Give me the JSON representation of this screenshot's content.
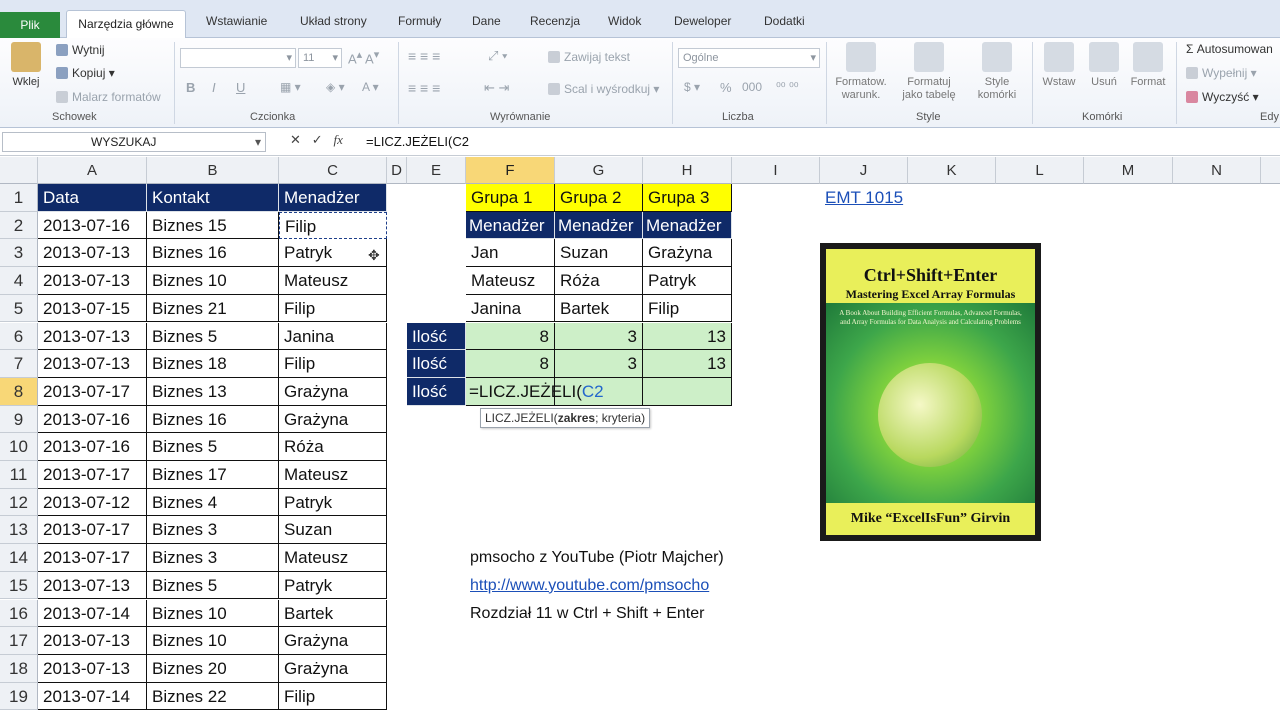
{
  "tabs": {
    "file": "Plik",
    "items": [
      "Narzędzia główne",
      "Wstawianie",
      "Układ strony",
      "Formuły",
      "Dane",
      "Recenzja",
      "Widok",
      "Deweloper",
      "Dodatki"
    ]
  },
  "ribbon": {
    "clipboard": {
      "paste": "Wklej",
      "cut": "Wytnij",
      "copy": "Kopiuj",
      "format_painter": "Malarz formatów",
      "label": "Schowek"
    },
    "font": {
      "font_name": "",
      "font_size": "11",
      "label": "Czcionka",
      "bold": "B",
      "italic": "I",
      "underline": "U"
    },
    "alignment": {
      "wrap": "Zawijaj tekst",
      "merge": "Scal i wyśrodkuj",
      "label": "Wyrównanie"
    },
    "number": {
      "format": "Ogólne",
      "percent": "%",
      "thousands": "000",
      "label": "Liczba"
    },
    "styles": {
      "conditional": "Formatow.\nwarunk.",
      "table": "Formatuj\njako tabelę",
      "cell_styles": "Style\nkomórki",
      "label": "Style"
    },
    "cells": {
      "insert": "Wstaw",
      "delete": "Usuń",
      "format": "Format",
      "label": "Komórki"
    },
    "editing": {
      "autosum": "Autosumowan",
      "fill": "Wypełnij",
      "clear": "Wyczyść",
      "label": "Edy"
    }
  },
  "formula_bar": {
    "name_box": "WYSZUKAJ",
    "fx": "fx",
    "formula": "=LICZ.JEŻELI(C2"
  },
  "columns": [
    "A",
    "B",
    "C",
    "D",
    "E",
    "F",
    "G",
    "H",
    "I",
    "J",
    "K",
    "L",
    "M",
    "N"
  ],
  "rows": [
    "1",
    "2",
    "3",
    "4",
    "5",
    "6",
    "7",
    "8",
    "9",
    "10",
    "11",
    "12",
    "13",
    "14",
    "15",
    "16",
    "17",
    "18",
    "19"
  ],
  "sheet": {
    "headers": {
      "a": "Data",
      "b": "Kontakt",
      "c": "Menadżer"
    },
    "data": [
      [
        "2013-07-16",
        "Biznes 15",
        "Filip"
      ],
      [
        "2013-07-13",
        "Biznes 16",
        "Patryk"
      ],
      [
        "2013-07-13",
        "Biznes 10",
        "Mateusz"
      ],
      [
        "2013-07-15",
        "Biznes 21",
        "Filip"
      ],
      [
        "2013-07-13",
        "Biznes 5",
        "Janina"
      ],
      [
        "2013-07-13",
        "Biznes 18",
        "Filip"
      ],
      [
        "2013-07-17",
        "Biznes 13",
        "Grażyna"
      ],
      [
        "2013-07-16",
        "Biznes 16",
        "Grażyna"
      ],
      [
        "2013-07-16",
        "Biznes 5",
        "Róża"
      ],
      [
        "2013-07-17",
        "Biznes 17",
        "Mateusz"
      ],
      [
        "2013-07-12",
        "Biznes 4",
        "Patryk"
      ],
      [
        "2013-07-17",
        "Biznes 3",
        "Suzan"
      ],
      [
        "2013-07-17",
        "Biznes 3",
        "Mateusz"
      ],
      [
        "2013-07-13",
        "Biznes 5",
        "Patryk"
      ],
      [
        "2013-07-14",
        "Biznes 10",
        "Bartek"
      ],
      [
        "2013-07-13",
        "Biznes 10",
        "Grażyna"
      ],
      [
        "2013-07-13",
        "Biznes 20",
        "Grażyna"
      ],
      [
        "2013-07-14",
        "Biznes 22",
        "Filip"
      ]
    ],
    "groups": [
      "Grupa 1",
      "Grupa 2",
      "Grupa 3"
    ],
    "group_header": "Menadżer",
    "group_members": [
      [
        "Jan",
        "Suzan",
        "Grażyna"
      ],
      [
        "Mateusz",
        "Róża",
        "Patryk"
      ],
      [
        "Janina",
        "Bartek",
        "Filip"
      ]
    ],
    "count_label": "Ilość",
    "counts_row6": [
      "8",
      "3",
      "13"
    ],
    "counts_row7": [
      "8",
      "3",
      "13"
    ],
    "editing_cell": "=LICZ.JEŻELI(",
    "editing_ref": "C2",
    "tooltip_fn": "LICZ.JEŻELI(",
    "tooltip_arg1": "zakres",
    "tooltip_rest": "; kryteria)",
    "emt_link": "EMT 1015",
    "note1": "pmsocho z  YouTube (Piotr Majcher)",
    "note2": "http://www.youtube.com/pmsocho",
    "note3": "Rozdział 11 w Ctrl + Shift + Enter"
  },
  "book": {
    "title": "Ctrl+Shift+Enter",
    "subtitle": "Mastering Excel Array Formulas",
    "blurb": "A Book About Building Efficient Formulas, Advanced Formulas, and Array Formulas for Data Analysis and Calculating Problems",
    "author": "Mike “ExcelIsFun” Girvin"
  }
}
